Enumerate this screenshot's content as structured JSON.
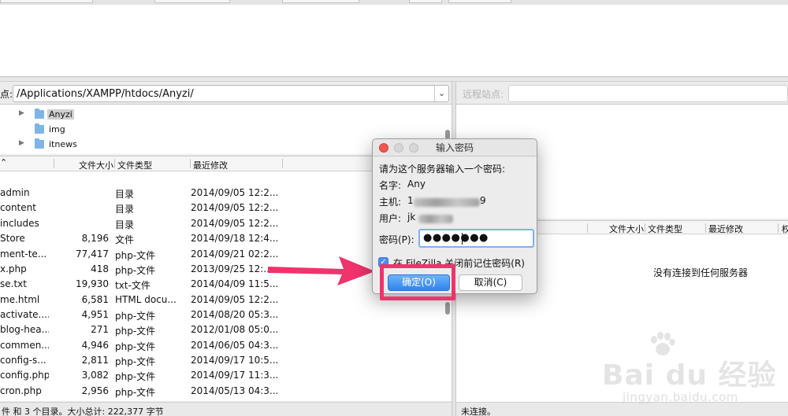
{
  "local": {
    "path_label": "点:",
    "path_value": "/Applications/XAMPP/htdocs/Anyzi/",
    "tree": [
      {
        "label": "Anyzi",
        "expandable": true,
        "selected": true
      },
      {
        "label": "img",
        "expandable": false,
        "selected": false
      },
      {
        "label": "itnews",
        "expandable": true,
        "selected": false
      }
    ],
    "columns": {
      "name": "",
      "size": "文件大小",
      "type": "文件类型",
      "modified": "最近修改"
    },
    "files": [
      {
        "name": "admin",
        "size": "",
        "type": "目录",
        "modified": "2014/09/05 12:2..."
      },
      {
        "name": "content",
        "size": "",
        "type": "目录",
        "modified": "2014/09/05 12:2..."
      },
      {
        "name": "includes",
        "size": "",
        "type": "目录",
        "modified": "2014/09/05 12:2..."
      },
      {
        "name": "Store",
        "size": "8,196",
        "type": "文件",
        "modified": "2014/09/18 12:4..."
      },
      {
        "name": "ment-te...",
        "size": "77,417",
        "type": "php-文件",
        "modified": "2014/09/21 02:2..."
      },
      {
        "name": "x.php",
        "size": "418",
        "type": "php-文件",
        "modified": "2013/09/25 12:..."
      },
      {
        "name": "se.txt",
        "size": "19,930",
        "type": "txt-文件",
        "modified": "2014/04/09 11:5..."
      },
      {
        "name": "me.html",
        "size": "6,581",
        "type": "HTML docu...",
        "modified": "2014/09/05 12:2..."
      },
      {
        "name": "activate....",
        "size": "4,951",
        "type": "php-文件",
        "modified": "2014/08/20 05:3..."
      },
      {
        "name": "blog-hea...",
        "size": "271",
        "type": "php-文件",
        "modified": "2012/01/08 05:0..."
      },
      {
        "name": "commen...",
        "size": "4,946",
        "type": "php-文件",
        "modified": "2014/06/05 04:3..."
      },
      {
        "name": "config-s...",
        "size": "2,811",
        "type": "php-文件",
        "modified": "2014/09/17 10:5..."
      },
      {
        "name": "config.php",
        "size": "3,082",
        "type": "php-文件",
        "modified": "2014/09/17 11:3..."
      },
      {
        "name": "cron.php",
        "size": "2,956",
        "type": "php-文件",
        "modified": "2014/05/13 04:3..."
      }
    ],
    "status": "件 和 3 个目录。大小总计: 222,377 字节"
  },
  "remote": {
    "path_label": "远程站点:",
    "path_value": "",
    "columns": {
      "size": "文件大小",
      "type": "文件类型",
      "modified": "最近修改",
      "perm": "权"
    },
    "empty_message": "没有连接到任何服务器",
    "status": "未连接。"
  },
  "dialog": {
    "title": "输入密码",
    "prompt": "请为这个服务器输入一个密码:",
    "name_label": "名字:",
    "name_value": "Any",
    "host_label": "主机:",
    "host_prefix": "1",
    "host_suffix": "9",
    "user_label": "用户:",
    "user_prefix": "jk",
    "password_label": "密码(P):",
    "password_mask": "●●●●●●●",
    "remember_label": "在 FileZilla 关闭前记住密码(R)",
    "remember_checked": true,
    "ok_label": "确定(O)",
    "cancel_label": "取消(C)"
  },
  "watermark": {
    "main": "Bai du 经验",
    "sub": "jingyan.baidu.com"
  },
  "colors": {
    "annotation": "#f0336d",
    "button_primary": "#2f84ee",
    "folder": "#7fb5e6"
  },
  "icons": {
    "folder": "folder-icon",
    "expand": "disclosure-triangle-icon",
    "dropdown": "chevron-down-icon",
    "annotation_arrow": "arrow-right-icon"
  }
}
